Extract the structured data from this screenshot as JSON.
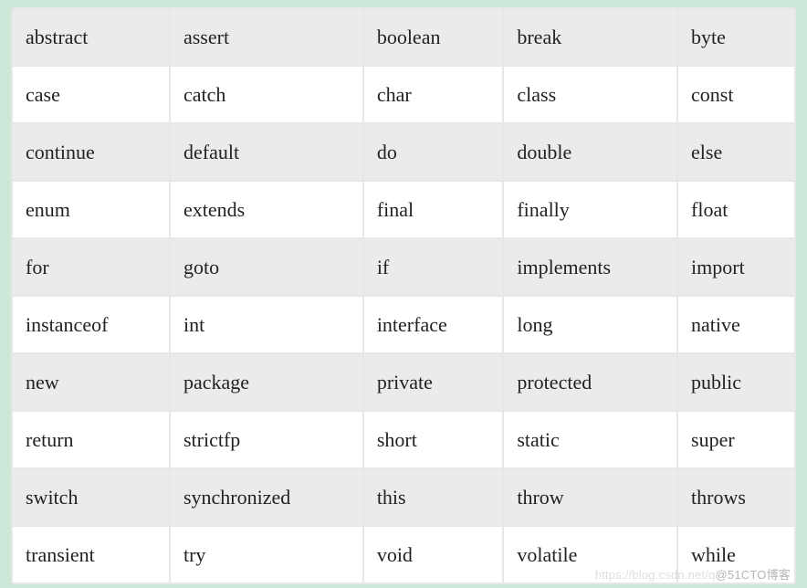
{
  "table": {
    "rows": [
      [
        "abstract",
        "assert",
        "boolean",
        "break",
        "byte"
      ],
      [
        "case",
        "catch",
        "char",
        "class",
        "const"
      ],
      [
        "continue",
        "default",
        "do",
        "double",
        "else"
      ],
      [
        "enum",
        "extends",
        "final",
        "finally",
        "float"
      ],
      [
        "for",
        "goto",
        "if",
        "implements",
        "import"
      ],
      [
        "instanceof",
        "int",
        "interface",
        "long",
        "native"
      ],
      [
        "new",
        "package",
        "private",
        "protected",
        "public"
      ],
      [
        "return",
        "strictfp",
        "short",
        "static",
        "super"
      ],
      [
        "switch",
        "synchronized",
        "this",
        "throw",
        "throws"
      ],
      [
        "transient",
        "try",
        "void",
        "volatile",
        "while"
      ]
    ]
  },
  "watermark": {
    "faint": "https://blog.csdn.net/q",
    "text": "@51CTO博客"
  }
}
